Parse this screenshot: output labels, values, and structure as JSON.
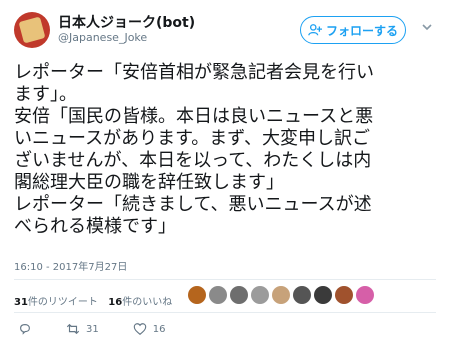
{
  "user": {
    "display_name": "日本人ジョーク(bot)",
    "handle": "@Japanese_Joke",
    "follow_label": "フォローする",
    "avatar_color": "#c0392b"
  },
  "tweet": {
    "lines": [
      "レポーター「安倍首相が緊急記者会見を行い",
      "ます」。",
      "安倍「国民の皆様。本日は良いニュースと悪",
      "いニュースがあります。まず、大変申し訳ご",
      "ざいませんが、本日を以って、わたくしは内",
      "閣総理大臣の職を辞任致します」",
      "レポーター「続きまして、悪いニュースが述",
      "べられる模様です」"
    ],
    "timestamp": "16:10 - 2017年7月27日"
  },
  "stats": {
    "retweet_count": "31",
    "retweet_label": "件のリツイート",
    "like_count": "16",
    "like_label": "件のいいね"
  },
  "actions": {
    "reply_count": "",
    "retweet_count": "31",
    "like_count": "16"
  },
  "icons": {
    "follow": "add-user-icon",
    "caret": "chevron-down-icon",
    "reply": "reply-icon",
    "retweet": "retweet-icon",
    "like": "heart-icon"
  },
  "colors": {
    "accent": "#1da1f2",
    "muted": "#657786",
    "liker_avatars": [
      "#b5651d",
      "#8a8a8a",
      "#6e6e6e",
      "#9b9b9b",
      "#c7a27a",
      "#555555",
      "#3a3a3a",
      "#a0522d",
      "#d65fa8"
    ]
  }
}
